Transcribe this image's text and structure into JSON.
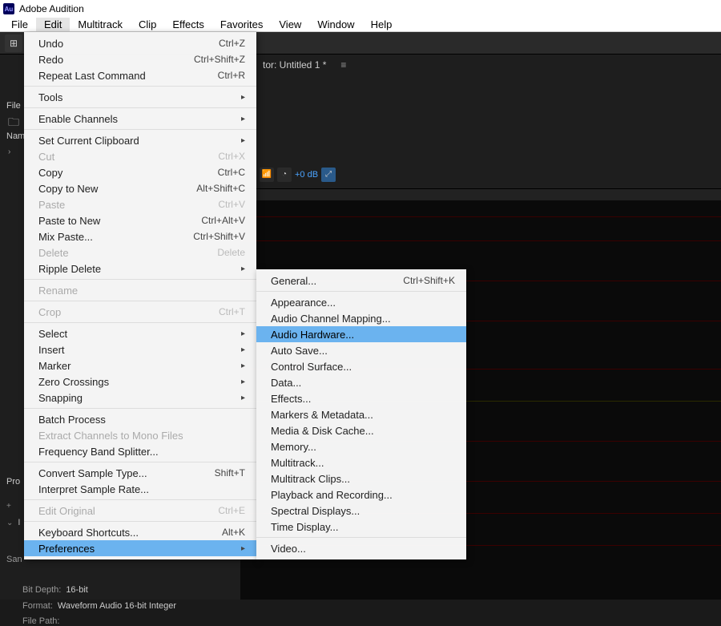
{
  "app": {
    "title": "Adobe Audition",
    "icon_text": "Au"
  },
  "menubar": [
    "File",
    "Edit",
    "Multitrack",
    "Clip",
    "Effects",
    "Favorites",
    "View",
    "Window",
    "Help"
  ],
  "active_menu_index": 1,
  "tab": {
    "label": "tor: Untitled 1 *"
  },
  "side": {
    "files": "File",
    "nam": "Nam"
  },
  "wave": {
    "db": "+0 dB"
  },
  "props": {
    "title": "Pro",
    "sam_label": "San",
    "bitdepth_key": "Bit Depth:",
    "bitdepth_val": "16-bit",
    "format_key": "Format:",
    "format_val": "Waveform Audio 16-bit Integer",
    "filepath_key": "File Path:"
  },
  "edit_menu": [
    {
      "label": "Undo",
      "shortcut": "Ctrl+Z"
    },
    {
      "label": "Redo",
      "shortcut": "Ctrl+Shift+Z"
    },
    {
      "label": "Repeat Last Command",
      "shortcut": "Ctrl+R"
    },
    {
      "sep": true
    },
    {
      "label": "Tools",
      "arrow": true
    },
    {
      "sep": true
    },
    {
      "label": "Enable Channels",
      "arrow": true
    },
    {
      "sep": true
    },
    {
      "label": "Set Current Clipboard",
      "arrow": true
    },
    {
      "label": "Cut",
      "shortcut": "Ctrl+X",
      "disabled": true
    },
    {
      "label": "Copy",
      "shortcut": "Ctrl+C"
    },
    {
      "label": "Copy to New",
      "shortcut": "Alt+Shift+C"
    },
    {
      "label": "Paste",
      "shortcut": "Ctrl+V",
      "disabled": true
    },
    {
      "label": "Paste to New",
      "shortcut": "Ctrl+Alt+V"
    },
    {
      "label": "Mix Paste...",
      "shortcut": "Ctrl+Shift+V"
    },
    {
      "label": "Delete",
      "shortcut": "Delete",
      "disabled": true
    },
    {
      "label": "Ripple Delete",
      "arrow": true
    },
    {
      "sep": true
    },
    {
      "label": "Rename",
      "disabled": true
    },
    {
      "sep": true
    },
    {
      "label": "Crop",
      "shortcut": "Ctrl+T",
      "disabled": true
    },
    {
      "sep": true
    },
    {
      "label": "Select",
      "arrow": true
    },
    {
      "label": "Insert",
      "arrow": true
    },
    {
      "label": "Marker",
      "arrow": true
    },
    {
      "label": "Zero Crossings",
      "arrow": true
    },
    {
      "label": "Snapping",
      "arrow": true
    },
    {
      "sep": true
    },
    {
      "label": "Batch Process"
    },
    {
      "label": "Extract Channels to Mono Files",
      "disabled": true
    },
    {
      "label": "Frequency Band Splitter..."
    },
    {
      "sep": true
    },
    {
      "label": "Convert Sample Type...",
      "shortcut": "Shift+T"
    },
    {
      "label": "Interpret Sample Rate..."
    },
    {
      "sep": true
    },
    {
      "label": "Edit Original",
      "shortcut": "Ctrl+E",
      "disabled": true
    },
    {
      "sep": true
    },
    {
      "label": "Keyboard Shortcuts...",
      "shortcut": "Alt+K"
    },
    {
      "label": "Preferences",
      "arrow": true,
      "highlight": true
    }
  ],
  "pref_submenu": [
    {
      "label": "General...",
      "shortcut": "Ctrl+Shift+K"
    },
    {
      "sep": true
    },
    {
      "label": "Appearance..."
    },
    {
      "label": "Audio Channel Mapping..."
    },
    {
      "label": "Audio Hardware...",
      "highlight": true
    },
    {
      "label": "Auto Save..."
    },
    {
      "label": "Control Surface..."
    },
    {
      "label": "Data..."
    },
    {
      "label": "Effects..."
    },
    {
      "label": "Markers & Metadata..."
    },
    {
      "label": "Media & Disk Cache..."
    },
    {
      "label": "Memory..."
    },
    {
      "label": "Multitrack..."
    },
    {
      "label": "Multitrack Clips..."
    },
    {
      "label": "Playback and Recording..."
    },
    {
      "label": "Spectral Displays..."
    },
    {
      "label": "Time Display..."
    },
    {
      "sep": true
    },
    {
      "label": "Video..."
    }
  ]
}
